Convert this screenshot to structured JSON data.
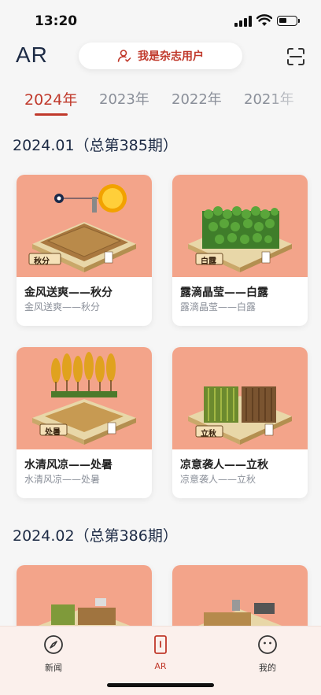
{
  "status_bar": {
    "time": "13:20"
  },
  "header": {
    "title": "AR",
    "magazine_user_label": "我是杂志用户"
  },
  "year_tabs": [
    {
      "label": "2024年",
      "active": true
    },
    {
      "label": "2023年",
      "active": false
    },
    {
      "label": "2022年",
      "active": false
    },
    {
      "label": "2021年",
      "active": false
    }
  ],
  "sections": [
    {
      "title": "2024.01（总第385期）",
      "cards": [
        {
          "name": "金风送爽——秋分",
          "subtitle": "金风送爽——秋分",
          "plaque": "秋分",
          "scene": "sun"
        },
        {
          "name": "露滴晶莹——白露",
          "subtitle": "露滴晶莹——白露",
          "plaque": "白露",
          "scene": "greenfield"
        },
        {
          "name": "水清风凉——处暑",
          "subtitle": "水清风凉——处暑",
          "plaque": "处暑",
          "scene": "trees"
        },
        {
          "name": "凉意袭人——立秋",
          "subtitle": "凉意袭人——立秋",
          "plaque": "立秋",
          "scene": "crops"
        }
      ]
    },
    {
      "title": "2024.02（总第386期）",
      "cards": [
        {
          "scene": "field2"
        },
        {
          "scene": "field3"
        }
      ]
    }
  ],
  "bottom_nav": [
    {
      "label": "新闻",
      "icon": "compass-icon",
      "active": false
    },
    {
      "label": "AR",
      "icon": "ar-card-icon",
      "active": true
    },
    {
      "label": "我的",
      "icon": "smile-icon",
      "active": false
    }
  ],
  "colors": {
    "accent": "#c0392b",
    "thumb_bg": "#f3a48a",
    "title_navy": "#1d2b45"
  }
}
